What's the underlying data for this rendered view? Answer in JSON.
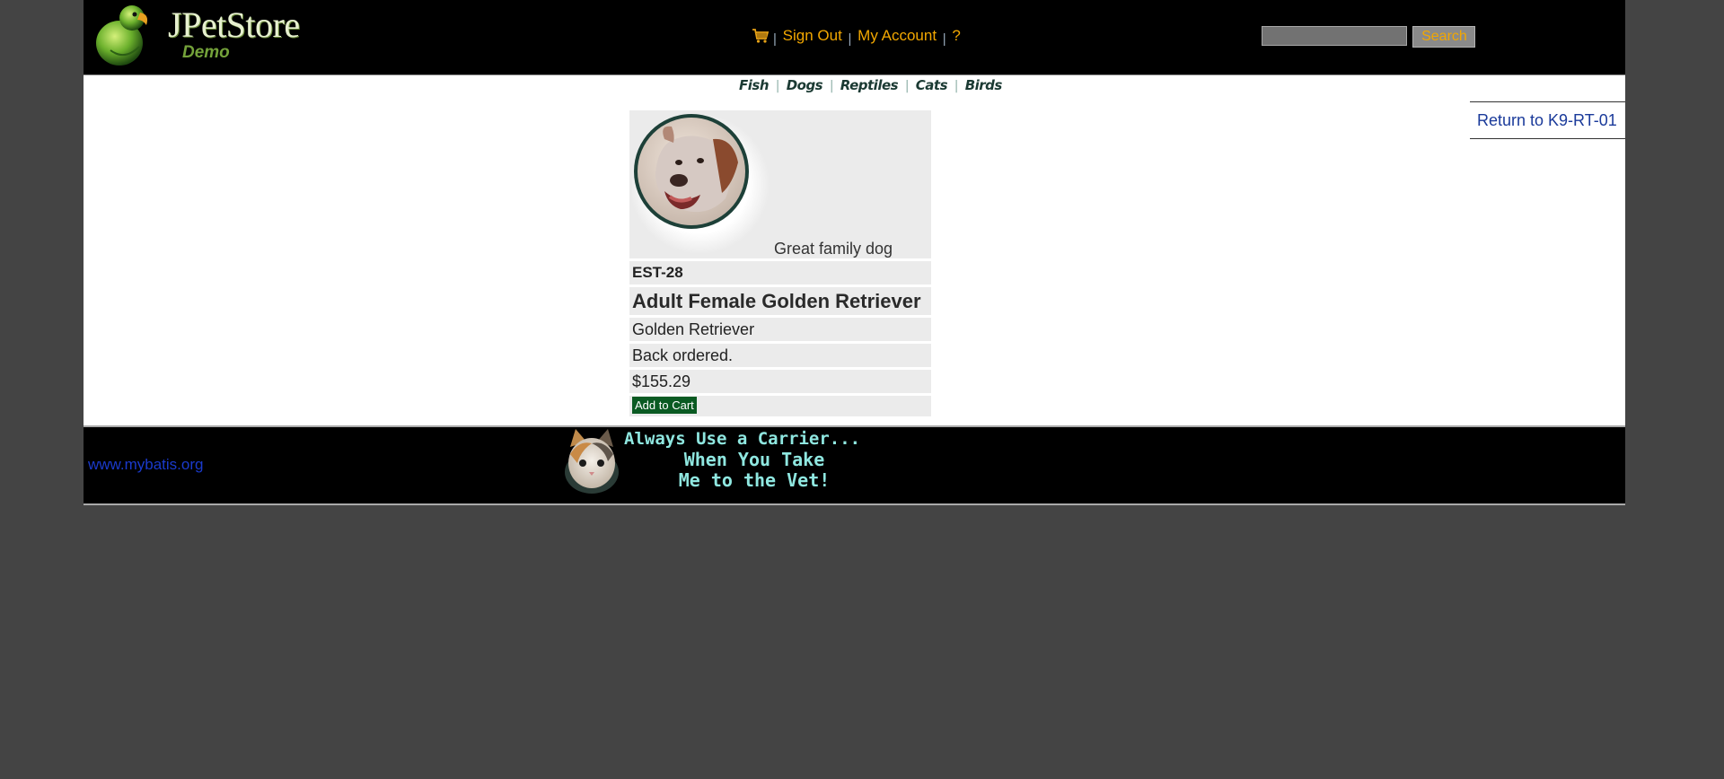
{
  "header": {
    "logo_title": "JPetStore",
    "logo_subtitle": "Demo",
    "menu": {
      "separator": "|",
      "sign_out": "Sign Out",
      "my_account": "My Account",
      "help": "?"
    },
    "search": {
      "input_value": "",
      "button_label": "Search"
    }
  },
  "quick_links": {
    "separator": "|",
    "items": [
      "Fish",
      "Dogs",
      "Reptiles",
      "Cats",
      "Birds"
    ]
  },
  "return_link": "Return to K9-RT-01",
  "item": {
    "description": "Great family dog",
    "item_id": "EST-28",
    "name": "Adult Female Golden Retriever",
    "product_name": "Golden Retriever",
    "stock": "Back ordered.",
    "price": "$155.29",
    "add_to_cart_label": "Add to Cart"
  },
  "footer": {
    "link": "www.mybatis.org",
    "banner_line1": "Always Use a Carrier...",
    "banner_line2": "When You Take",
    "banner_line3": "Me to the Vet!"
  },
  "colors": {
    "page_bg": "#444444",
    "header_bg": "#000000",
    "menu_link": "#f2a700",
    "add_to_cart_bg": "#0a5a22",
    "cell_bg": "#ebebeb",
    "footer_link": "#1a3acc"
  },
  "icons": {
    "cart": "cart-icon",
    "logo": "parrot-logo-icon",
    "pet_image": "dog-photo",
    "banner_cat": "cat-photo"
  }
}
